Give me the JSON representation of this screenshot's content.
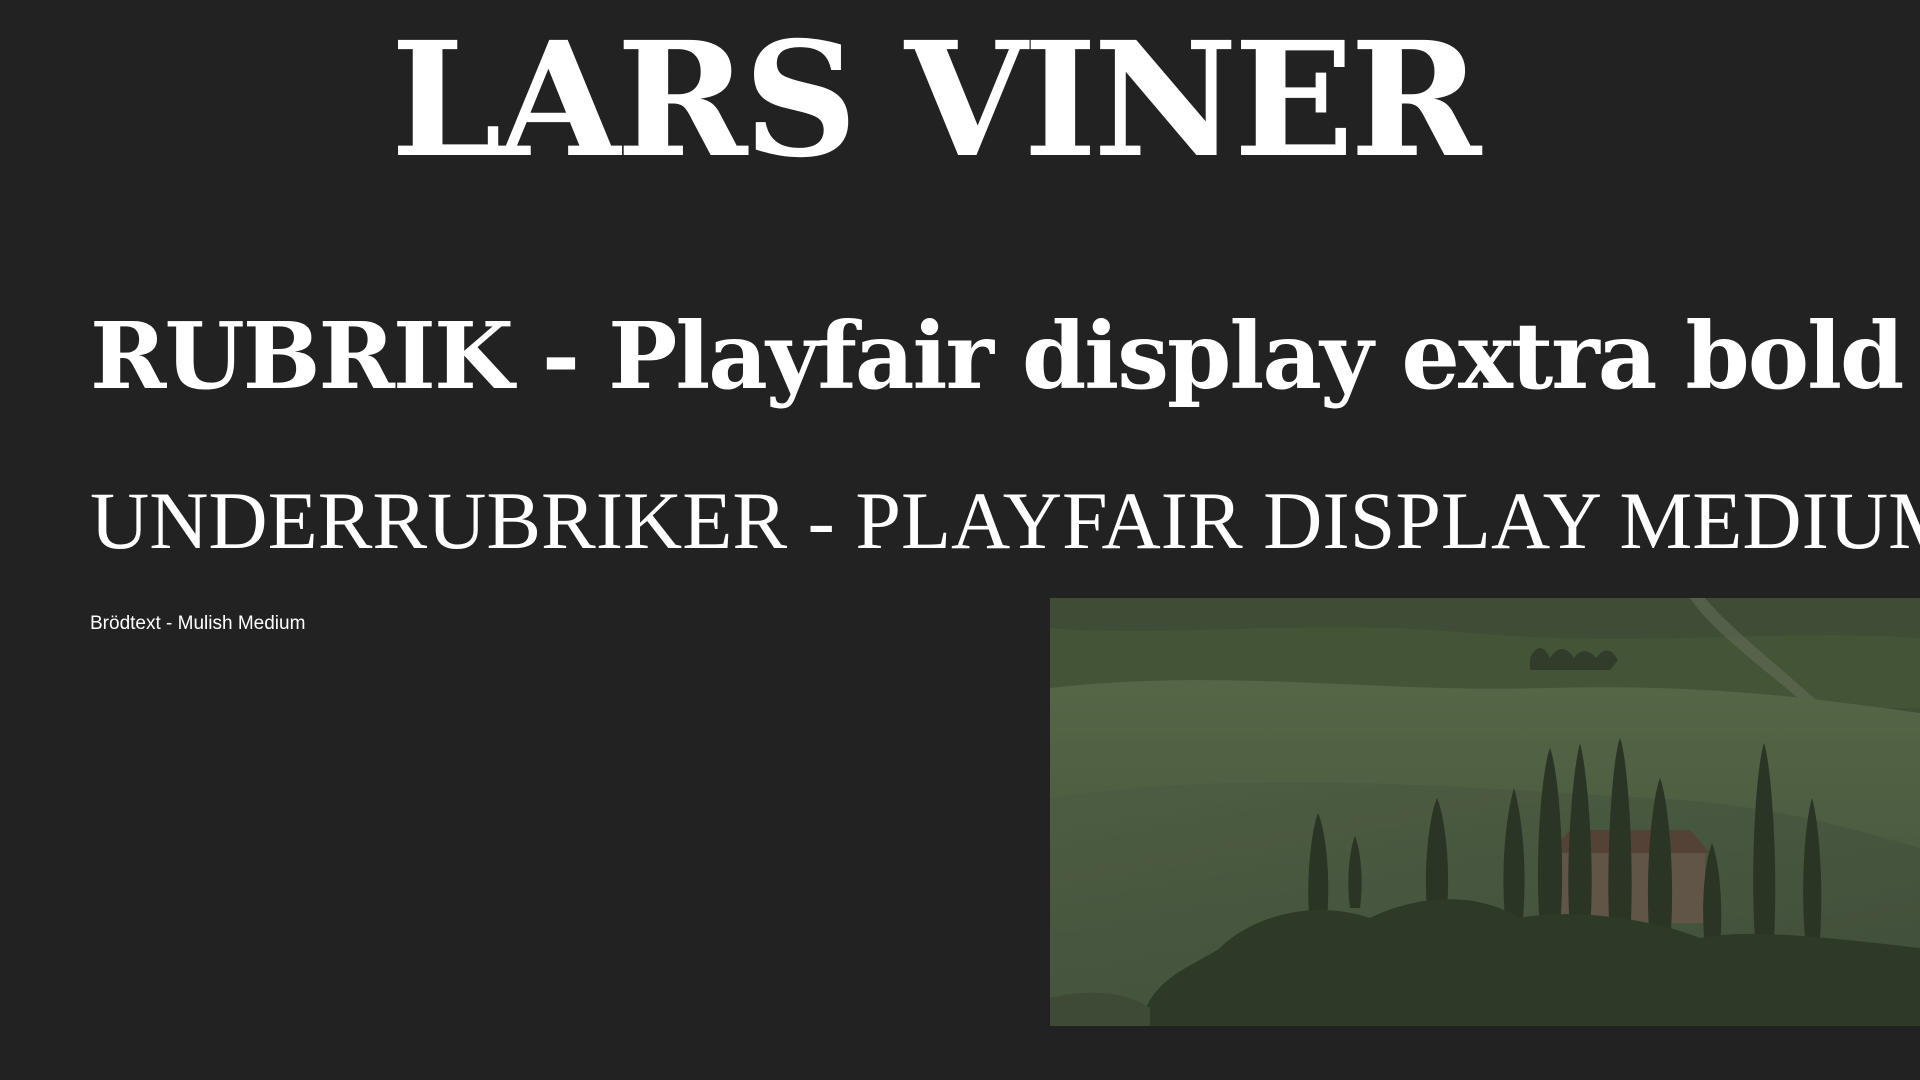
{
  "brand": {
    "title": "LARS VINER"
  },
  "typography": {
    "heading_sample": "RUBRIK - Playfair display extra bold",
    "subheading_sample": "UNDERRUBRIKER - PLAYFAIR DISPLAY MEDIUM",
    "body_sample": "Brödtext - Mulish Medium"
  },
  "colors": {
    "background": "#222222",
    "text": "#ffffff",
    "landscape_tint": "#5a6e4c"
  },
  "image": {
    "subject": "tuscan-landscape-with-cypress-trees-and-villa"
  }
}
